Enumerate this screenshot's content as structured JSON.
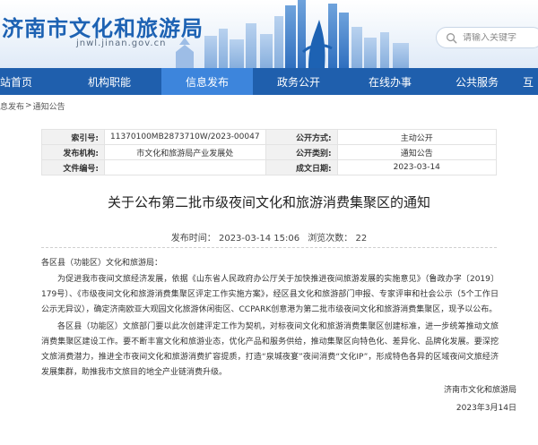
{
  "header": {
    "site_title": "济南市文化和旅游局",
    "site_domain": "jnwl.jinan.gov.cn",
    "search_placeholder": "请输入关键字",
    "brand_color": "#1f5fad"
  },
  "nav": {
    "items": [
      {
        "label": "站首页"
      },
      {
        "label": "机构职能"
      },
      {
        "label": "信息发布",
        "active": true
      },
      {
        "label": "政务公开"
      },
      {
        "label": "在线办事"
      },
      {
        "label": "公共服务"
      },
      {
        "label": "互"
      }
    ],
    "active_color": "#3d85dc"
  },
  "breadcrumb": {
    "items": [
      "息发布",
      "通知公告"
    ],
    "separator": ">"
  },
  "meta": {
    "index_label": "索引号:",
    "index_value": "11370100MB2873710W/2023-00047",
    "disclosure_label": "公开方式:",
    "disclosure_value": "主动公开",
    "org_label": "发布机构:",
    "org_value": "市文化和旅游局产业发展处",
    "category_label": "公开类别:",
    "category_value": "通知公告",
    "docno_label": "文件编号:",
    "docno_value": "",
    "date_label": "成文日期:",
    "date_value": "2023-03-14"
  },
  "article": {
    "title": "关于公布第二批市级夜间文化和旅游消费集聚区的通知",
    "publish_time": "发布时间：  2023-03-14 15:06",
    "views": "浏览次数：  22",
    "salutation": "各区县（功能区）文化和旅游局：",
    "paragraphs": [
      "为促进我市夜间文旅经济发展，依据《山东省人民政府办公厅关于加快推进夜间旅游发展的实施意见》（鲁政办字〔2019〕179号）、《市级夜间文化和旅游消费集聚区评定工作实施方案》，经区县文化和旅游部门申报、专家评审和社会公示（5个工作日公示无异议），确定济南欧亚大观园文化旅游休闲街区、CCPARK创意港为第二批市级夜间文化和旅游消费集聚区，现予以公布。",
      "各区县（功能区）文旅部门要以此次创建评定工作为契机，对标夜间文化和旅游消费集聚区创建标准，进一步统筹推动文旅消费集聚区建设工作。要不断丰富文化和旅游业态，优化产品和服务供给，推动集聚区向特色化、差异化、品牌化发展。要深挖文旅消费潜力，推进全市夜间文化和旅游消费扩容提质，打造“泉城夜宴”夜间消费“文化IP”，形成特色各异的区域夜间文旅经济发展集群，助推我市文旅目的地全产业链消费升级。"
    ],
    "sign_org": "济南市文化和旅游局",
    "sign_date": "2023年3月14日"
  }
}
